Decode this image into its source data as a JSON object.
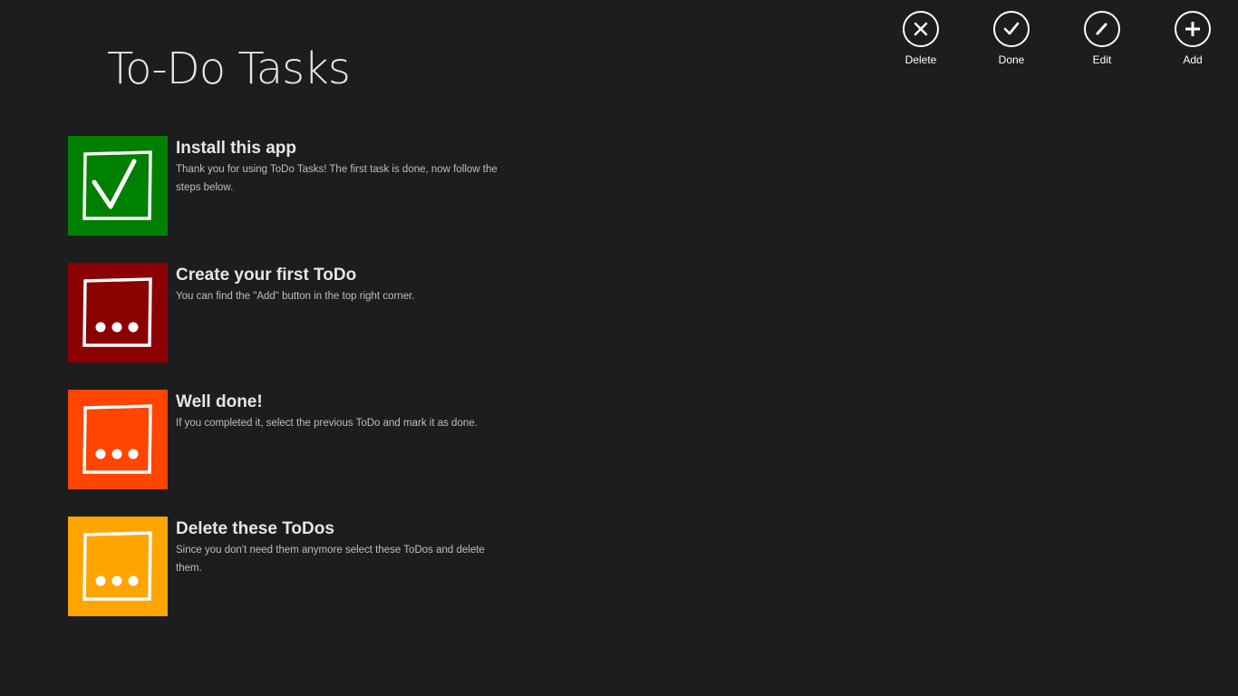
{
  "header": {
    "title": "To-Do Tasks"
  },
  "appbar": {
    "buttons": [
      {
        "label": "Delete",
        "icon": "close-icon"
      },
      {
        "label": "Done",
        "icon": "checkmark-icon"
      },
      {
        "label": "Edit",
        "icon": "pencil-icon"
      },
      {
        "label": "Add",
        "icon": "plus-icon"
      }
    ]
  },
  "todos": [
    {
      "title": "Install this app",
      "description": "Thank you for using ToDo Tasks! The first task is done, now follow the steps below.",
      "status": "done",
      "color": "#008000",
      "icon": "checkmark-icon"
    },
    {
      "title": "Create your first ToDo",
      "description": "You can find the \"Add\" button in the top right corner.",
      "status": "pending",
      "color": "#8b0000",
      "icon": "ellipsis-icon"
    },
    {
      "title": "Well done!",
      "description": "If you completed it, select the previous ToDo and mark it as done.",
      "status": "pending",
      "color": "#ff4500",
      "icon": "ellipsis-icon"
    },
    {
      "title": "Delete these ToDos",
      "description": "Since you don't need them anymore select these ToDos and delete them.",
      "status": "pending",
      "color": "#ffa500",
      "icon": "ellipsis-icon"
    }
  ]
}
